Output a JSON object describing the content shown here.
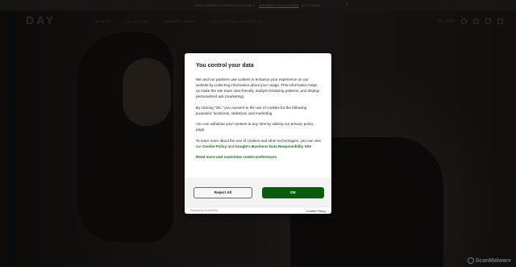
{
  "announcement": {
    "text": "NEW SPRING STORIES AVAILABLE.",
    "link": "BROWSE COLLECTION",
    "suffix": "IN STORES"
  },
  "header": {
    "logo": "DAY",
    "nav": [
      "WOMEN",
      "COLLECTION",
      "BUSINESS SHOP",
      "PROFESSIONAL GARMENTS"
    ],
    "region": "SE / SEK"
  },
  "consent": {
    "title": "You control your data",
    "paragraph1": "We and our partners use cookies to enhance your experience on our website by collecting information about your usage. This information helps us make the site more user-friendly, analyze browsing patterns, and display personalized ads (marketing).",
    "paragraph2": "By clicking \"OK,\" you consent to the use of cookies for the following purposes: functional, statistical, and marketing.",
    "paragraph3": "You can withdraw your consent at any time by visiting our privacy policy page.",
    "paragraph4_prefix": "To learn more about the use of cookies and other technologies, you can visit our",
    "cookie_policy_link": "Cookie Policy",
    "and": "and",
    "google_link": "Google's Business Data Responsibility Site",
    "customize_link": "Read more and customize cookie preferences",
    "reject_label": "Reject All",
    "ok_label": "OK",
    "powered_by": "Powered by CookieFirst",
    "footer_policy": "Cookie Policy"
  },
  "watermark": "ScanMalware"
}
